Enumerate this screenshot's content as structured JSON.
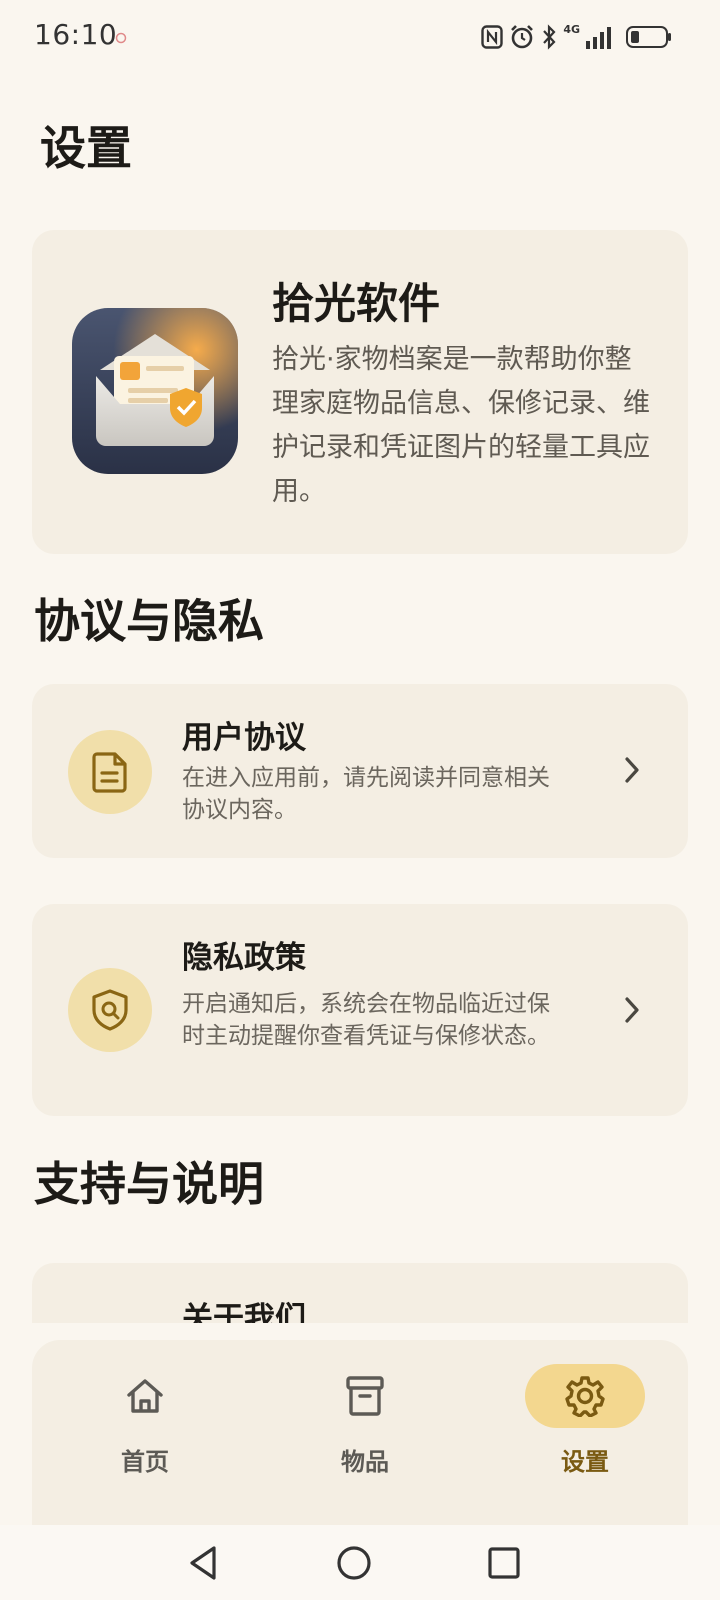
{
  "status_bar": {
    "time": "16:10",
    "icons": [
      "nfc-icon",
      "alarm-icon",
      "bluetooth-icon",
      "signal-4g-icon",
      "battery-icon"
    ],
    "network_label": "4G"
  },
  "page": {
    "title": "设置"
  },
  "about": {
    "app_name": "拾光软件",
    "description": "拾光·家物档案是一款帮助你整理家庭物品信息、保修记录、维护记录和凭证图片的轻量工具应用。"
  },
  "sections": {
    "agreements_title": "协议与隐私",
    "support_title": "支持与说明"
  },
  "agreement_items": [
    {
      "title": "用户协议",
      "desc": "在进入应用前，请先阅读并同意相关协议内容。",
      "icon": "document-icon"
    },
    {
      "title": "隐私政策",
      "desc": "开启通知后，系统会在物品临近过保时主动提醒你查看凭证与保修状态。",
      "icon": "shield-icon"
    }
  ],
  "support_items": [
    {
      "title": "关于我们"
    }
  ],
  "bottom_nav": [
    {
      "label": "首页",
      "icon": "home-icon",
      "active": false
    },
    {
      "label": "物品",
      "icon": "archive-box-icon",
      "active": false
    },
    {
      "label": "设置",
      "icon": "gear-icon",
      "active": true
    }
  ],
  "colors": {
    "background": "#faf6ef",
    "card": "#f4eee3",
    "accent": "#f3d78f",
    "accent_icon": "#8a6614"
  }
}
